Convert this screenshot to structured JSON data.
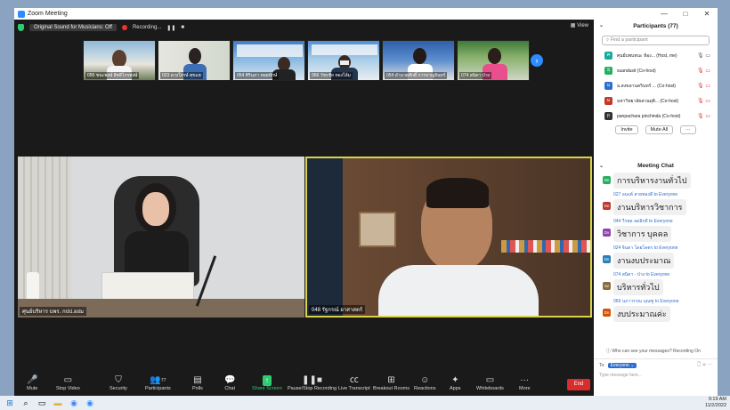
{
  "window": {
    "title": "Zoom Meeting"
  },
  "topbar": {
    "sound": "Original Sound for Musicians: Off",
    "recording": "Recording...",
    "view": "View"
  },
  "thumbs": [
    {
      "label": "055 ชนะพงษ์ สิทธิไกรพงษ์"
    },
    {
      "label": "023 ดวงใจรษ์ ศุขแฮ"
    },
    {
      "label": "054 ศิรินภา หอยทักษ์"
    },
    {
      "label": "066 วัชรชัย ทองไล้ม"
    },
    {
      "label": "054 อำนวยศักดิ์ การจาญจันทร์"
    },
    {
      "label": "074 สนิตา ป่วง"
    }
  ],
  "tiles": {
    "left": "ศุนย์บริหาร บพร. กปป.อย่ม",
    "right": "048 รัฐกรณ์ อาสาสตร์"
  },
  "toolbar": {
    "mute": "Mute",
    "video": "Stop Video",
    "security": "Security",
    "participants": "Participants",
    "participants_count": "77",
    "polls": "Polls",
    "chat": "Chat",
    "share": "Share Screen",
    "record": "Pause/Stop Recording",
    "transcript": "Live Transcript",
    "breakout": "Breakout Rooms",
    "reactions": "Reactions",
    "apps": "Apps",
    "whiteboards": "Whiteboards",
    "more": "More",
    "end": "End"
  },
  "panel": {
    "title": "Participants (77)",
    "search_placeholder": "Find a participant",
    "participants": [
      {
        "name": "ศุนย์บพบหนะ ห้อง...  (Host, me)",
        "color": "#1aa9a0",
        "initial": "ศ"
      },
      {
        "name": "suandusit (Co-host)",
        "color": "#27ae60",
        "initial": "S"
      },
      {
        "name": "ม.สงขลานครินทร์ ... (Co-host)",
        "color": "#2d6fcf",
        "initial": "ม"
      },
      {
        "name": "มหาวิทยาลัยสวนดุสิ... (Co-host)",
        "color": "#c0392b",
        "initial": "ม"
      },
      {
        "name": "panpachara pinchinda (Co-host)",
        "color": "#333333",
        "initial": "p"
      }
    ],
    "invite": "Invite",
    "mute_all": "Mute All",
    "more": "···"
  },
  "chat": {
    "title": "Meeting Chat",
    "messages": [
      {
        "from": "",
        "text": "การบริหารงานทั่วไป",
        "color": "#27ae60",
        "initial": "Dn"
      },
      {
        "from": "027 อนงค์ สายทองดี  to  Everyone",
        "text": "งานบริหารวิชาการ",
        "color": "#c0392b",
        "initial": "Dn"
      },
      {
        "from": "044 วีรพล ลดลิกดี  to  Everyone",
        "text": "วิชาการ บุคคล",
        "color": "#8e44ad",
        "initial": "Dv"
      },
      {
        "from": "024 จิ่นดา โดยโคตร  to  Everyone",
        "text": "งานงบประมาณ",
        "color": "#2980b9",
        "initial": "Dn"
      },
      {
        "from": "074 สนิตา - ป่วง  to  Everyone",
        "text": "บริหารทั่วไป",
        "color": "#8a6d3b",
        "initial": "av"
      },
      {
        "from": "069 นภาวรรณ บุณฑู  to  Everyone",
        "text": "งบประมาณค่ะ",
        "color": "#d35400",
        "initial": "Dn"
      }
    ],
    "notice": "Who can see your messages? Recording On",
    "to_label": "To:",
    "to_value": "Everyone",
    "placeholder": "Type message here..."
  },
  "taskbar": {
    "time": "9:19 AM",
    "date": "11/2/2022"
  }
}
